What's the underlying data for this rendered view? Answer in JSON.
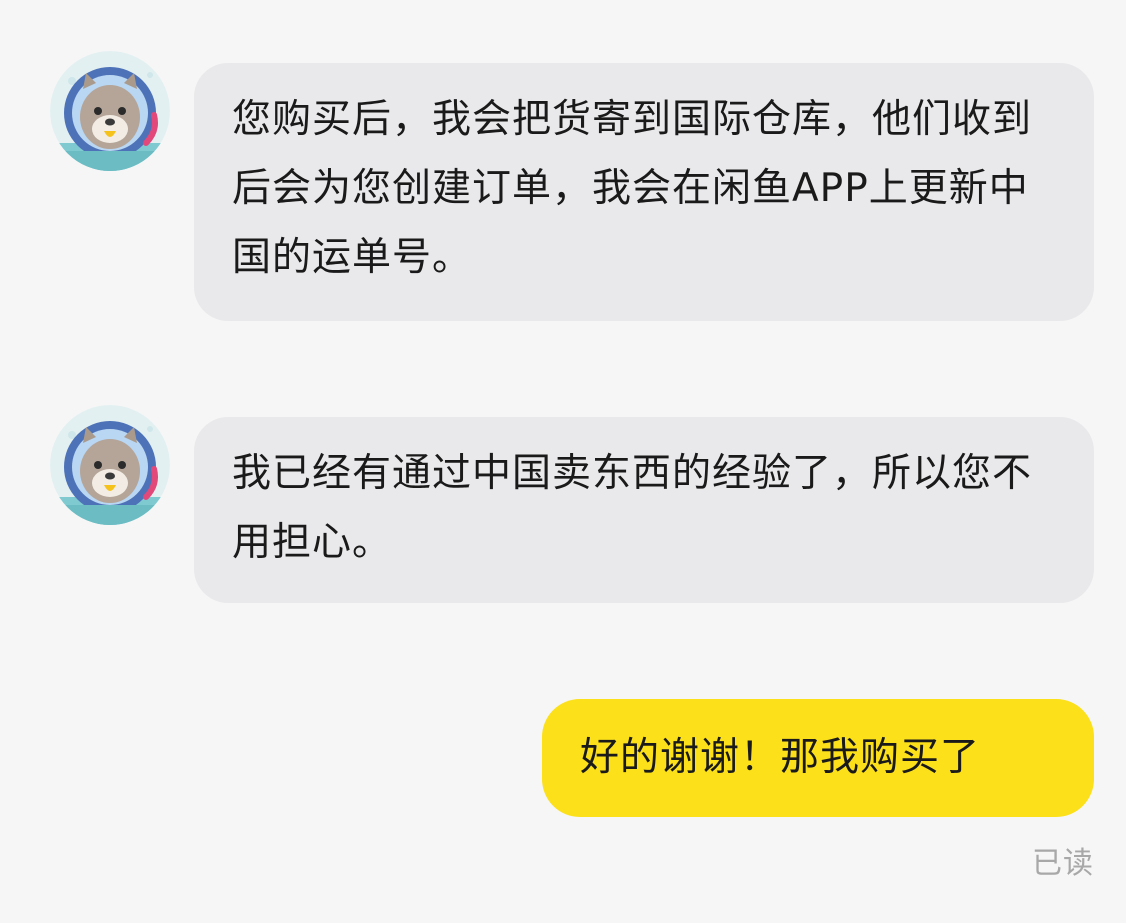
{
  "colors": {
    "background": "#f6f6f6",
    "incoming_bubble": "#e9e9ec",
    "outgoing_bubble": "#fbe01a",
    "read_status": "#a8a8a8"
  },
  "messages": [
    {
      "sender": "other",
      "avatar_icon": "seal-astronaut-avatar-icon",
      "text": "您购买后，我会把货寄到国际仓库，他们收到后会为您创建订单，我会在闲鱼APP上更新中国的运单号。"
    },
    {
      "sender": "other",
      "avatar_icon": "seal-astronaut-avatar-icon",
      "text": "我已经有通过中国卖东西的经验了，所以您不用担心。"
    },
    {
      "sender": "me",
      "text": "好的谢谢！那我购买了"
    }
  ],
  "read_status": "已读"
}
